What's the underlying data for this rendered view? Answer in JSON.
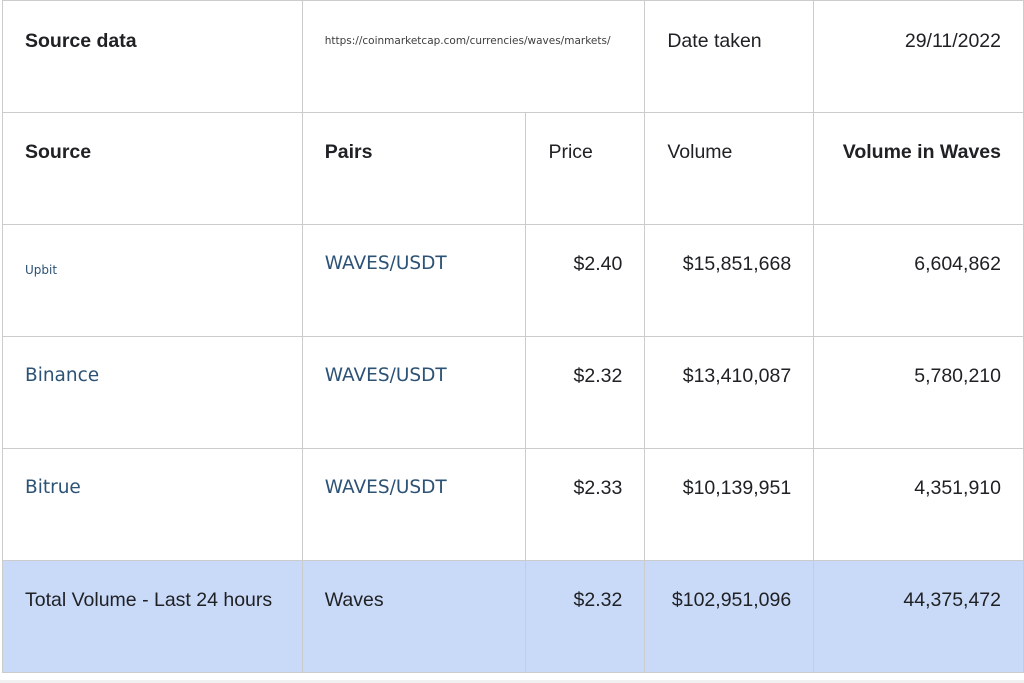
{
  "header": {
    "source_label": "Source data",
    "source_url": "https://coinmarketcap.com/currencies/waves/markets/",
    "date_label": "Date taken",
    "date_value": "29/11/2022"
  },
  "columns": [
    "Source",
    "Pairs",
    "Price",
    "Volume",
    "Volume in Waves"
  ],
  "rows": [
    {
      "source": "Upbit",
      "pair": "WAVES/USDT",
      "price": "$2.40",
      "volume": "$15,851,668",
      "volume_waves": "6,604,862"
    },
    {
      "source": "Binance",
      "pair": "WAVES/USDT",
      "price": "$2.32",
      "volume": "$13,410,087",
      "volume_waves": "5,780,210"
    },
    {
      "source": "Bitrue",
      "pair": "WAVES/USDT",
      "price": "$2.33",
      "volume": "$10,139,951",
      "volume_waves": "4,351,910"
    }
  ],
  "total": {
    "label": "Total Volume - Last 24 hours",
    "pair": "Waves",
    "price": "$2.32",
    "volume": "$102,951,096",
    "volume_waves": "44,375,472"
  },
  "colors": {
    "total_row_bg": "#c9daf8",
    "link": "#2c5275",
    "border": "#cccccc"
  }
}
